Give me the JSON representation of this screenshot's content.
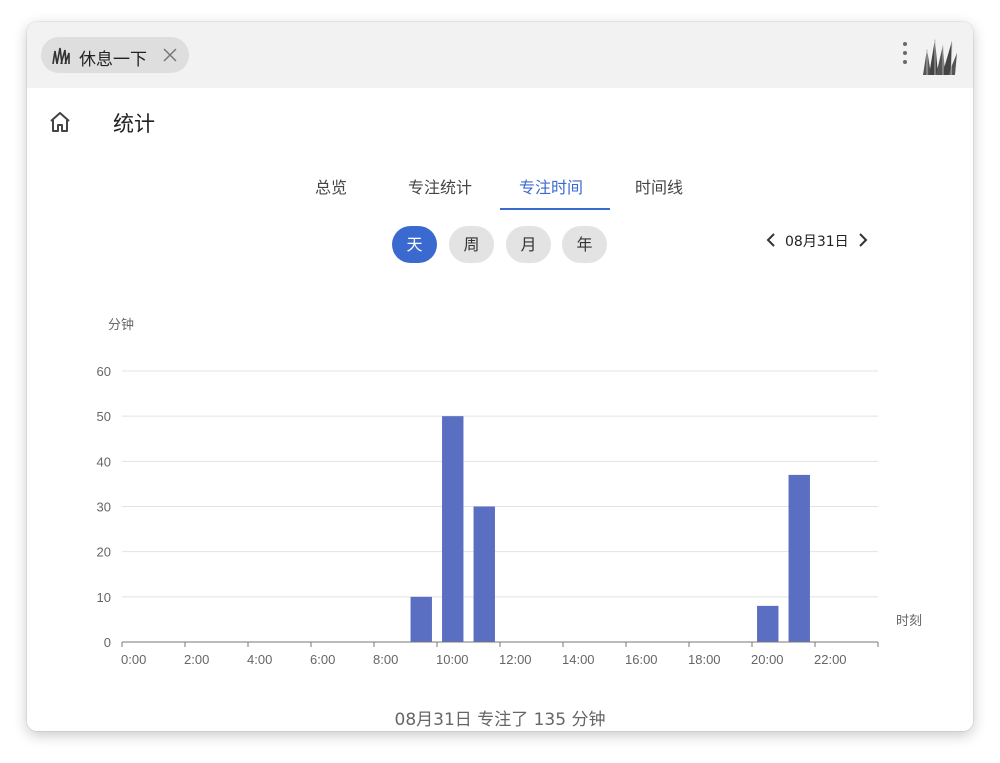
{
  "tab": {
    "title": "休息一下"
  },
  "page": {
    "title": "统计"
  },
  "tabs": [
    {
      "label": "总览"
    },
    {
      "label": "专注统计"
    },
    {
      "label": "专注时间"
    },
    {
      "label": "时间线"
    }
  ],
  "active_tab": "专注时间",
  "ranges": [
    {
      "label": "天"
    },
    {
      "label": "周"
    },
    {
      "label": "月"
    },
    {
      "label": "年"
    }
  ],
  "active_range": "天",
  "date": {
    "label": "08月31日"
  },
  "colors": {
    "accent": "#3a6ad0",
    "bar": "#5b6fc2"
  },
  "icons": [
    "grass-icon",
    "close-icon",
    "more-vert-icon",
    "home-icon",
    "chevron-left-icon",
    "chevron-right-icon"
  ],
  "chart_data": {
    "type": "bar",
    "ylabel": "分钟",
    "xlabel": "时刻",
    "ylim": [
      0,
      60
    ],
    "yticks": [
      0,
      10,
      20,
      30,
      40,
      50,
      60
    ],
    "xtick_labels": [
      "0:00",
      "2:00",
      "4:00",
      "6:00",
      "8:00",
      "10:00",
      "12:00",
      "14:00",
      "16:00",
      "18:00",
      "20:00",
      "22:00"
    ],
    "hours": [
      0,
      1,
      2,
      3,
      4,
      5,
      6,
      7,
      8,
      9,
      10,
      11,
      12,
      13,
      14,
      15,
      16,
      17,
      18,
      19,
      20,
      21,
      22,
      23
    ],
    "values": [
      0,
      0,
      0,
      0,
      0,
      0,
      0,
      0,
      0,
      10,
      50,
      30,
      0,
      0,
      0,
      0,
      0,
      0,
      0,
      0,
      8,
      37,
      0,
      0
    ],
    "grid": true,
    "legend": "none"
  },
  "summary": {
    "text": "08月31日 专注了 135 分钟"
  }
}
